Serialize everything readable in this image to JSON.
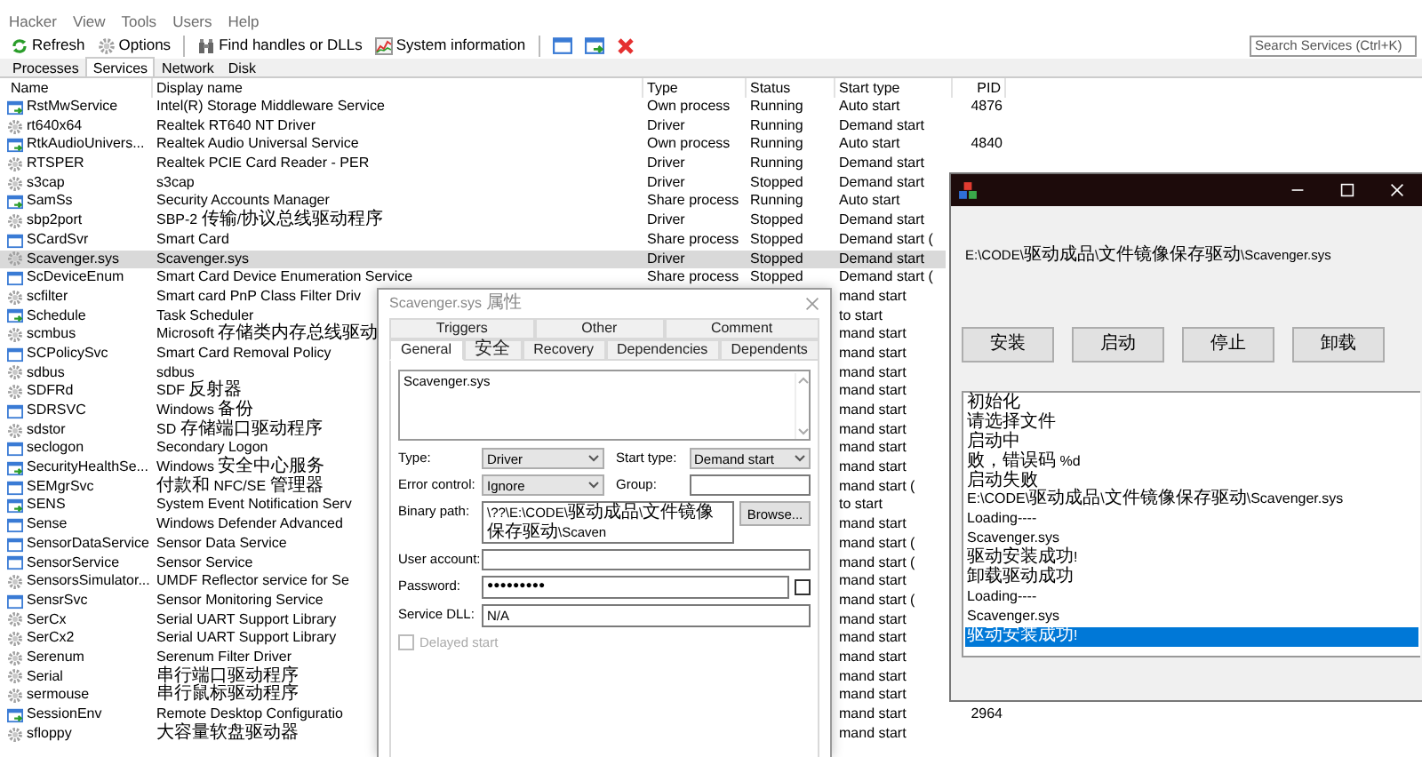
{
  "menu": [
    "Hacker",
    "View",
    "Tools",
    "Users",
    "Help"
  ],
  "toolbar": [
    "Refresh",
    "Options",
    "Find handles or DLLs",
    "System information"
  ],
  "search": {
    "placeholder": "Search Services (Ctrl+K)"
  },
  "tabs": [
    {
      "label": "Processes",
      "selected": false
    },
    {
      "label": "Services",
      "selected": true
    },
    {
      "label": "Network",
      "selected": false
    },
    {
      "label": "Disk",
      "selected": false
    }
  ],
  "table": {
    "columns": [
      "Name",
      "Display name",
      "Type",
      "Status",
      "Start type",
      "PID"
    ],
    "rows": [
      {
        "kind": "running",
        "name": "RstMwService",
        "display_name": "Intel(R) Storage Middleware Service",
        "type": "Own process",
        "status": "Running",
        "start_type": "Auto start",
        "pid": "4876",
        "selected": false
      },
      {
        "kind": "driver",
        "name": "rt640x64",
        "display_name": "Realtek RT640 NT Driver",
        "type": "Driver",
        "status": "Running",
        "start_type": "Demand start",
        "selected": false
      },
      {
        "kind": "running",
        "name": "RtkAudioUnivers...",
        "display_name": "Realtek Audio Universal Service",
        "type": "Own process",
        "status": "Running",
        "start_type": "Auto start",
        "pid": "4840",
        "selected": false
      },
      {
        "kind": "driver",
        "name": "RTSPER",
        "display_name": "Realtek PCIE Card Reader - PER",
        "type": "Driver",
        "status": "Running",
        "start_type": "Demand start",
        "selected": false
      },
      {
        "kind": "driver",
        "name": "s3cap",
        "display_name": "s3cap",
        "type": "Driver",
        "status": "Stopped",
        "start_type": "Demand start",
        "selected": false
      },
      {
        "kind": "running",
        "name": "SamSs",
        "display_name": "Security Accounts Manager",
        "type": "Share process",
        "status": "Running",
        "start_type": "Auto start",
        "selected": false
      },
      {
        "kind": "driver",
        "name": "sbp2port",
        "display_name": "SBP-2 传输/协议总线驱动程序",
        "type": "Driver",
        "status": "Stopped",
        "start_type": "Demand start",
        "selected": false
      },
      {
        "kind": "service",
        "name": "SCardSvr",
        "display_name": "Smart Card",
        "type": "Share process",
        "status": "Stopped",
        "start_type": "Demand start (",
        "selected": false
      },
      {
        "kind": "driver",
        "name": "Scavenger.sys",
        "display_name": "Scavenger.sys",
        "type": "Driver",
        "status": "Stopped",
        "start_type": "Demand start",
        "selected": true
      },
      {
        "kind": "service",
        "name": "ScDeviceEnum",
        "display_name": "Smart Card Device Enumeration Service",
        "type": "Share process",
        "status": "Stopped",
        "start_type": "Demand start (",
        "selected": false
      },
      {
        "kind": "driver",
        "name": "scfilter",
        "display_name": "Smart card PnP Class Filter Driv",
        "start_type": "mand start",
        "selected": false
      },
      {
        "kind": "running",
        "name": "Schedule",
        "display_name": "Task Scheduler",
        "start_type": "to start",
        "selected": false
      },
      {
        "kind": "driver",
        "name": "scmbus",
        "display_name": "Microsoft 存储类内存总线驱动",
        "start_type": "mand start",
        "selected": false
      },
      {
        "kind": "service",
        "name": "SCPolicySvc",
        "display_name": "Smart Card Removal Policy",
        "start_type": "mand start",
        "selected": false
      },
      {
        "kind": "driver",
        "name": "sdbus",
        "display_name": "sdbus",
        "start_type": "mand start",
        "selected": false
      },
      {
        "kind": "driver",
        "name": "SDFRd",
        "display_name": "SDF 反射器",
        "start_type": "mand start",
        "selected": false
      },
      {
        "kind": "service",
        "name": "SDRSVC",
        "display_name": "Windows 备份",
        "start_type": "mand start",
        "selected": false
      },
      {
        "kind": "driver",
        "name": "sdstor",
        "display_name": "SD 存储端口驱动程序",
        "start_type": "mand start",
        "selected": false
      },
      {
        "kind": "service",
        "name": "seclogon",
        "display_name": "Secondary Logon",
        "start_type": "mand start",
        "selected": false
      },
      {
        "kind": "running",
        "name": "SecurityHealthSe...",
        "display_name": "Windows 安全中心服务",
        "start_type": "mand start",
        "selected": false
      },
      {
        "kind": "service",
        "name": "SEMgrSvc",
        "display_name": "付款和 NFC/SE 管理器",
        "start_type": "mand start (",
        "selected": false
      },
      {
        "kind": "running",
        "name": "SENS",
        "display_name": "System Event Notification Serv",
        "start_type": "to start",
        "selected": false
      },
      {
        "kind": "service",
        "name": "Sense",
        "display_name": "Windows Defender Advanced",
        "start_type": "mand start",
        "selected": false
      },
      {
        "kind": "service",
        "name": "SensorDataService",
        "display_name": "Sensor Data Service",
        "start_type": "mand start (",
        "selected": false
      },
      {
        "kind": "service",
        "name": "SensorService",
        "display_name": "Sensor Service",
        "start_type": "mand start (",
        "selected": false
      },
      {
        "kind": "driver",
        "name": "SensorsSimulator...",
        "display_name": "UMDF Reflector service for Se",
        "start_type": "mand start",
        "selected": false
      },
      {
        "kind": "service",
        "name": "SensrSvc",
        "display_name": "Sensor Monitoring Service",
        "start_type": "mand start (",
        "selected": false
      },
      {
        "kind": "driver",
        "name": "SerCx",
        "display_name": "Serial UART Support Library",
        "start_type": "mand start",
        "selected": false
      },
      {
        "kind": "driver",
        "name": "SerCx2",
        "display_name": "Serial UART Support Library",
        "start_type": "mand start",
        "selected": false
      },
      {
        "kind": "driver",
        "name": "Serenum",
        "display_name": "Serenum Filter Driver",
        "start_type": "mand start",
        "selected": false
      },
      {
        "kind": "driver",
        "name": "Serial",
        "display_name": "串行端口驱动程序",
        "start_type": "mand start",
        "selected": false
      },
      {
        "kind": "driver",
        "name": "sermouse",
        "display_name": "串行鼠标驱动程序",
        "start_type": "mand start",
        "selected": false
      },
      {
        "kind": "running",
        "name": "SessionEnv",
        "display_name": "Remote Desktop Configuratio",
        "start_type": "mand start",
        "pid": "2964",
        "selected": false
      },
      {
        "kind": "driver",
        "name": "sfloppy",
        "display_name": "大容量软盘驱动器",
        "start_type": "mand start",
        "selected": false
      }
    ]
  },
  "dialog": {
    "title": "Scavenger.sys 属性",
    "back_tabs": [
      "Triggers",
      "Other",
      "Comment"
    ],
    "tabs": [
      {
        "label": "General",
        "selected": true
      },
      {
        "label": "安全",
        "selected": false
      },
      {
        "label": "Recovery",
        "selected": false
      },
      {
        "label": "Dependencies",
        "selected": false
      },
      {
        "label": "Dependents",
        "selected": false
      }
    ],
    "description": "Scavenger.sys",
    "form_rows": [
      {
        "fields": [
          {
            "label": "Type:",
            "kind": "select",
            "value": "Driver"
          },
          {
            "label": "Start type:",
            "kind": "select",
            "value": "Demand start"
          }
        ]
      },
      {
        "fields": [
          {
            "label": "Error control:",
            "kind": "select",
            "value": "Ignore"
          },
          {
            "label": "Group:",
            "kind": "text"
          }
        ]
      },
      {
        "fields": [
          {
            "label": "Binary path:",
            "kind": "text",
            "value": "\\??\\E:\\CODE\\驱动成品\\文件镜像保存驱动\\Scaven"
          }
        ],
        "button": "Browse..."
      },
      {
        "fields": [
          {
            "label": "User account:",
            "kind": "text"
          }
        ]
      },
      {
        "fields": [
          {
            "label": "Password:",
            "kind": "password",
            "value": "●●●●●●●●●"
          }
        ],
        "checkbox": {
          "checked": false
        }
      },
      {
        "fields": [
          {
            "label": "Service DLL:",
            "kind": "text",
            "value": "N/A"
          }
        ]
      }
    ],
    "delayed_start": {
      "label": "Delayed start",
      "checked": false,
      "disabled": true
    }
  },
  "tool_window": {
    "path": "E:\\CODE\\驱动成品\\文件镜像保存驱动\\Scavenger.sys",
    "buttons": [
      "安装",
      "启动",
      "停止",
      "卸载"
    ],
    "log": [
      {
        "text": "初始化",
        "selected": false
      },
      {
        "text": "请选择文件",
        "selected": false
      },
      {
        "text": "启动中",
        "selected": false
      },
      {
        "text": "败，错误码 %d",
        "selected": false
      },
      {
        "text": "启动失败",
        "selected": false
      },
      {
        "text": "E:\\CODE\\驱动成品\\文件镜像保存驱动\\Scavenger.sys",
        "selected": false
      },
      {
        "text": "Loading----",
        "selected": false
      },
      {
        "text": "Scavenger.sys",
        "selected": false
      },
      {
        "text": "驱动安装成功!",
        "selected": false
      },
      {
        "text": "卸载驱动成功",
        "selected": false
      },
      {
        "text": "Loading----",
        "selected": false
      },
      {
        "text": "Scavenger.sys",
        "selected": false
      },
      {
        "text": "驱动安装成功!",
        "selected": true
      }
    ]
  }
}
